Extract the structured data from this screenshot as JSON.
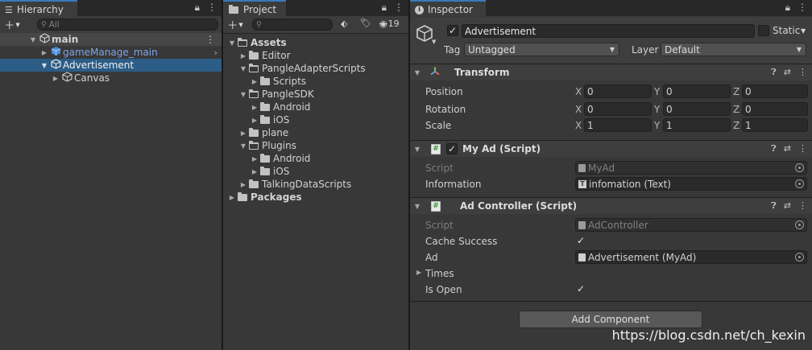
{
  "hierarchy": {
    "tab_label": "Hierarchy",
    "search_placeholder": "All",
    "rows": [
      {
        "label": "main",
        "depth": 0
      },
      {
        "label": "gameManage_main",
        "depth": 1
      },
      {
        "label": "Advertisement",
        "depth": 1
      },
      {
        "label": "Canvas",
        "depth": 2
      }
    ]
  },
  "project": {
    "tab_label": "Project",
    "hidden_count": "19",
    "tree": [
      {
        "label": "Assets",
        "bold": true
      },
      {
        "label": "Editor"
      },
      {
        "label": "PangleAdapterScripts"
      },
      {
        "label": "Scripts"
      },
      {
        "label": "PangleSDK"
      },
      {
        "label": "Android"
      },
      {
        "label": "iOS"
      },
      {
        "label": "plane"
      },
      {
        "label": "Plugins"
      },
      {
        "label": "Android"
      },
      {
        "label": "iOS"
      },
      {
        "label": "TalkingDataScripts"
      },
      {
        "label": "Packages",
        "bold": true
      }
    ]
  },
  "inspector": {
    "tab_label": "Inspector",
    "object_name": "Advertisement",
    "static_label": "Static",
    "tag_label": "Tag",
    "tag_value": "Untagged",
    "layer_label": "Layer",
    "layer_value": "Default",
    "transform": {
      "title": "Transform",
      "position_label": "Position",
      "rotation_label": "Rotation",
      "scale_label": "Scale",
      "axis_x": "X",
      "axis_y": "Y",
      "axis_z": "Z",
      "position": [
        "0",
        "0",
        "0"
      ],
      "rotation": [
        "0",
        "0",
        "0"
      ],
      "scale": [
        "1",
        "1",
        "1"
      ]
    },
    "myad": {
      "title": "My Ad (Script)",
      "script_label": "Script",
      "script_value": "MyAd",
      "info_label": "Information",
      "info_value": "infomation (Text)"
    },
    "adcontroller": {
      "title": "Ad Controller (Script)",
      "script_label": "Script",
      "script_value": "AdController",
      "cache_label": "Cache Success",
      "ad_label": "Ad",
      "ad_value": "Advertisement (MyAd)",
      "times_label": "Times",
      "isopen_label": "Is Open"
    },
    "add_component": "Add Component"
  },
  "watermark": "https://blog.csdn.net/ch_kexin",
  "colors": {
    "selection": "#2c5d87",
    "tab_accent": "#3a79bb",
    "prefab_blue": "#7fa6e6"
  }
}
